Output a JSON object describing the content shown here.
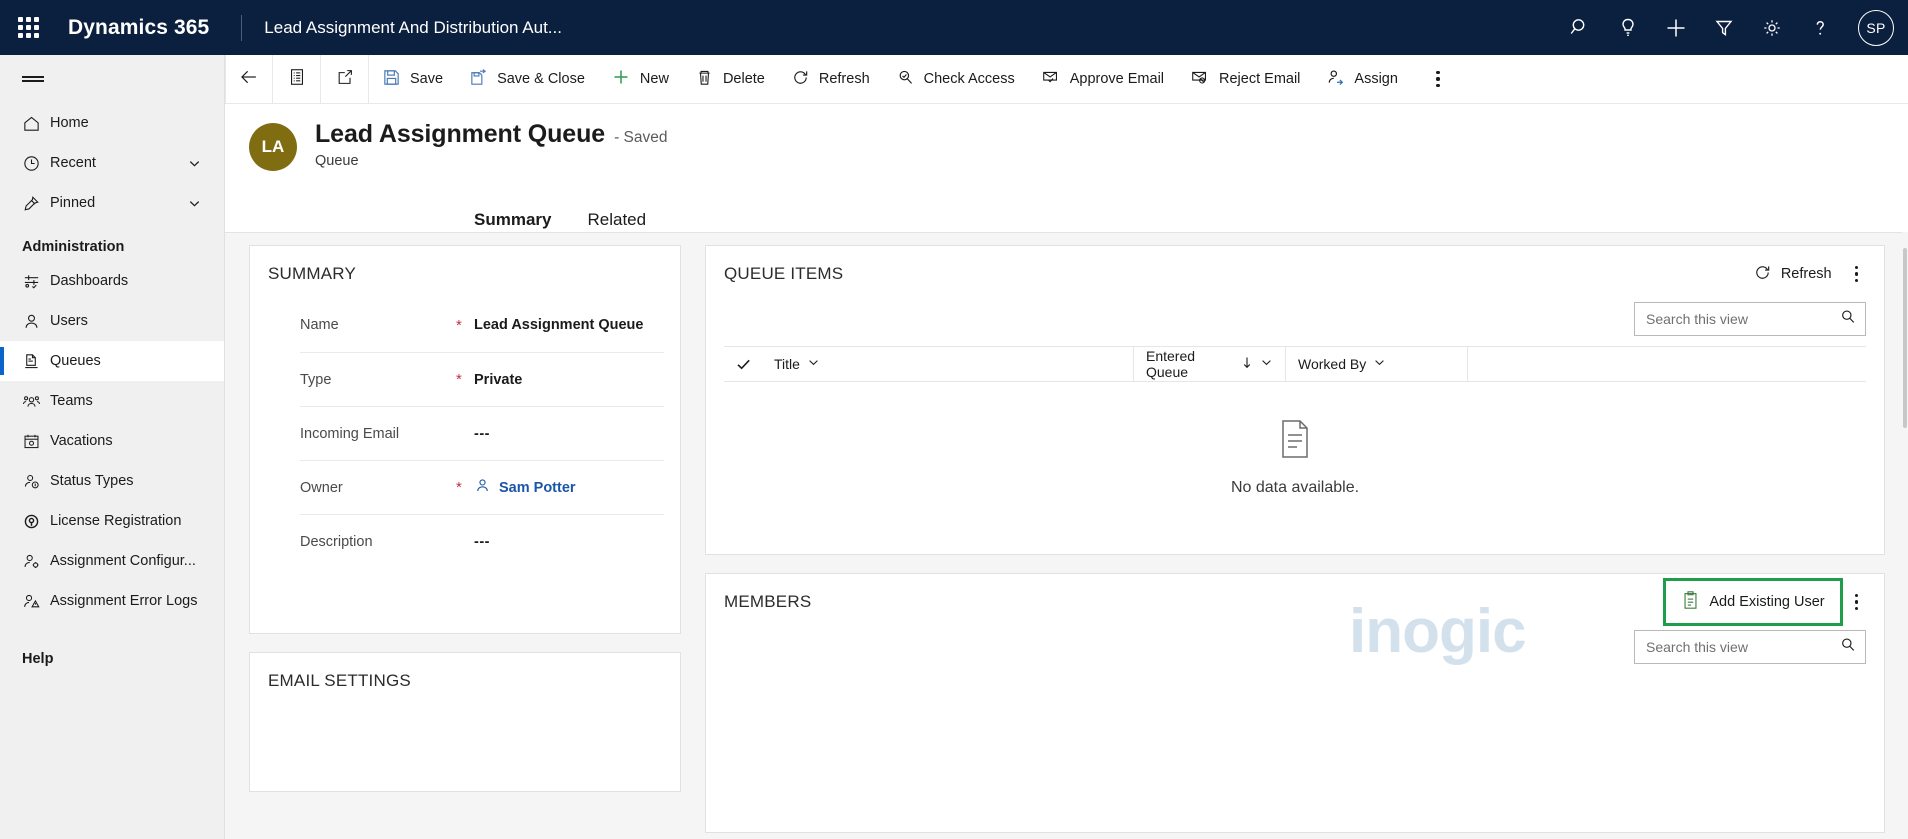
{
  "topbar": {
    "waffle_label": "app-launcher",
    "brand": "Dynamics 365",
    "app_name": "Lead Assignment And Distribution Aut...",
    "icons": [
      "search-icon",
      "lightbulb-icon",
      "plus-icon",
      "filter-icon",
      "gear-icon",
      "help-icon"
    ],
    "avatar_initials": "SP"
  },
  "sidebar": {
    "items": [
      {
        "label": "Home",
        "icon": "home-icon",
        "selected": false,
        "chevron": false
      },
      {
        "label": "Recent",
        "icon": "clock-icon",
        "selected": false,
        "chevron": true
      },
      {
        "label": "Pinned",
        "icon": "pin-icon",
        "selected": false,
        "chevron": true
      }
    ],
    "group_label": "Administration",
    "admin_items": [
      {
        "label": "Dashboards",
        "icon": "dashboard-icon",
        "selected": false
      },
      {
        "label": "Users",
        "icon": "user-icon",
        "selected": false
      },
      {
        "label": "Queues",
        "icon": "queue-icon",
        "selected": true
      },
      {
        "label": "Teams",
        "icon": "team-icon",
        "selected": false
      },
      {
        "label": "Vacations",
        "icon": "vacation-calendar-icon",
        "selected": false
      },
      {
        "label": "Status Types",
        "icon": "status-type-icon",
        "selected": false
      },
      {
        "label": "License Registration",
        "icon": "license-icon",
        "selected": false
      },
      {
        "label": "Assignment Configur...",
        "icon": "assignment-config-icon",
        "selected": false
      },
      {
        "label": "Assignment Error Logs",
        "icon": "assignment-error-icon",
        "selected": false
      }
    ],
    "help_label": "Help"
  },
  "commandbar": {
    "back_icon": "back-arrow-icon",
    "form_icon": "form-selector-icon",
    "popout_icon": "open-in-new-window-icon",
    "buttons": [
      {
        "label": "Save",
        "icon": "save-icon"
      },
      {
        "label": "Save & Close",
        "icon": "save-close-icon"
      },
      {
        "label": "New",
        "icon": "plus-icon"
      },
      {
        "label": "Delete",
        "icon": "trash-icon"
      },
      {
        "label": "Refresh",
        "icon": "refresh-icon"
      },
      {
        "label": "Check Access",
        "icon": "check-access-icon"
      },
      {
        "label": "Approve Email",
        "icon": "approve-email-icon"
      },
      {
        "label": "Reject Email",
        "icon": "reject-email-icon"
      },
      {
        "label": "Assign",
        "icon": "assign-user-icon"
      }
    ],
    "overflow_label": "more-commands"
  },
  "record": {
    "avatar_initials": "LA",
    "avatar_color": "#806d11",
    "title": "Lead Assignment Queue",
    "saved_state": "- Saved",
    "entity": "Queue",
    "tabs": [
      {
        "label": "Summary",
        "active": true
      },
      {
        "label": "Related",
        "active": false
      }
    ]
  },
  "summary": {
    "title": "SUMMARY",
    "fields": [
      {
        "label": "Name",
        "required": true,
        "value": "Lead Assignment Queue",
        "type": "text"
      },
      {
        "label": "Type",
        "required": true,
        "value": "Private",
        "type": "text"
      },
      {
        "label": "Incoming Email",
        "required": false,
        "value": "---",
        "type": "text"
      },
      {
        "label": "Owner",
        "required": true,
        "value": "Sam Potter",
        "type": "lookup"
      },
      {
        "label": "Description",
        "required": false,
        "value": "---",
        "type": "text"
      }
    ]
  },
  "email_settings": {
    "title": "EMAIL SETTINGS"
  },
  "queue_items": {
    "title": "QUEUE ITEMS",
    "refresh_label": "Refresh",
    "refresh_icon": "refresh-icon",
    "overflow_label": "more-options",
    "search_placeholder": "Search this view",
    "search_value": "",
    "search_icon": "search-icon",
    "columns": [
      {
        "label": "Title",
        "sort": "none"
      },
      {
        "label": "Entered Queue",
        "sort": "asc"
      },
      {
        "label": "Worked By",
        "sort": "none"
      }
    ],
    "empty_text": "No data available.",
    "empty_icon": "empty-document-icon"
  },
  "members": {
    "title": "MEMBERS",
    "add_existing_user_label": "Add Existing User",
    "add_existing_user_icon": "add-existing-record-icon",
    "highlighted": true,
    "highlight_color": "#1e9e4a",
    "overflow_label": "more-options",
    "search_placeholder": "Search this view",
    "search_value": "",
    "search_icon": "search-icon"
  },
  "watermark": {
    "text": "inogic"
  }
}
